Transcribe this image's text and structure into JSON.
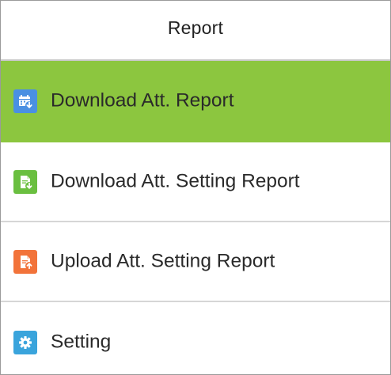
{
  "header": {
    "title": "Report"
  },
  "menu": {
    "items": [
      {
        "label": "Download Att. Report",
        "icon": "calendar-download-icon",
        "icon_color": "#4a90e2",
        "active": true
      },
      {
        "label": "Download Att. Setting Report",
        "icon": "document-download-icon",
        "icon_color": "#6abf40",
        "active": false
      },
      {
        "label": "Upload Att. Setting Report",
        "icon": "document-upload-icon",
        "icon_color": "#f2733a",
        "active": false
      },
      {
        "label": "Setting",
        "icon": "gear-icon",
        "icon_color": "#3aa4dc",
        "active": false
      }
    ]
  },
  "colors": {
    "active_background": "#8cc63f",
    "divider": "#d6d6d6"
  }
}
